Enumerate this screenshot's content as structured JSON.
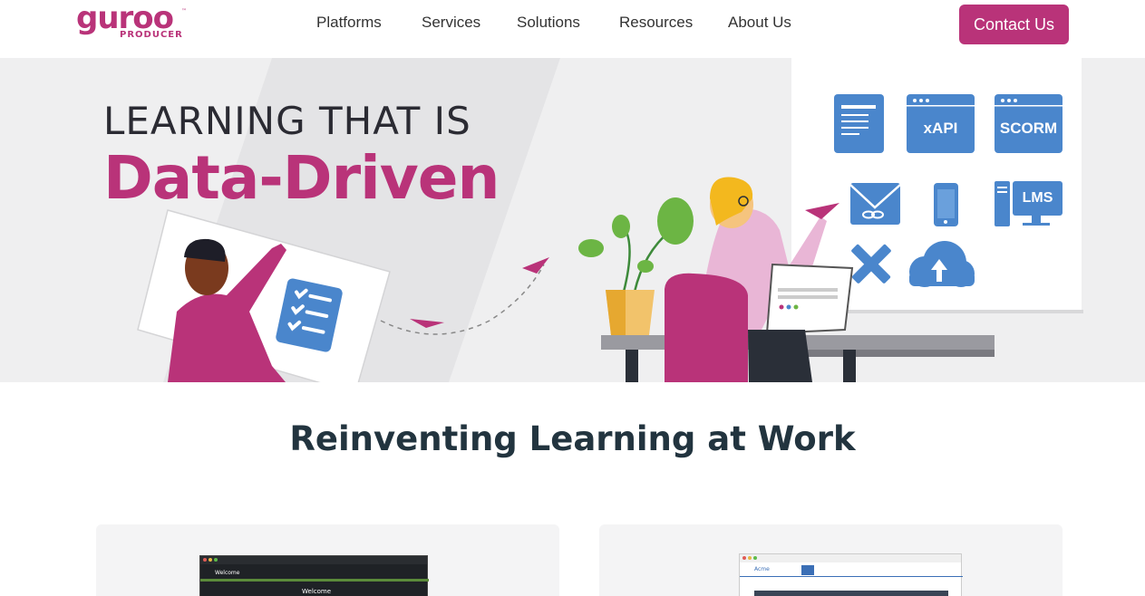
{
  "brand": {
    "name": "guroo",
    "tm": "™",
    "sub": "PRODUCER"
  },
  "nav": {
    "items": [
      "Platforms",
      "Services",
      "Solutions",
      "Resources",
      "About Us"
    ],
    "cta": "Contact Us"
  },
  "hero": {
    "line1": "LEARNING THAT IS",
    "line2": "Data-Driven",
    "icons": {
      "xapi": "xAPI",
      "scorm": "SCORM",
      "lms": "LMS"
    }
  },
  "section": {
    "title": "Reinventing Learning at Work"
  },
  "cards": {
    "left": {
      "screen_welcome_small": "Welcome",
      "screen_welcome": "Welcome"
    },
    "right": {
      "screen_brand": "Acme"
    }
  },
  "colors": {
    "accent": "#b93379",
    "icon_blue": "#4a86cc",
    "heading": "#22343f",
    "hero_bg": "#efeff0"
  }
}
